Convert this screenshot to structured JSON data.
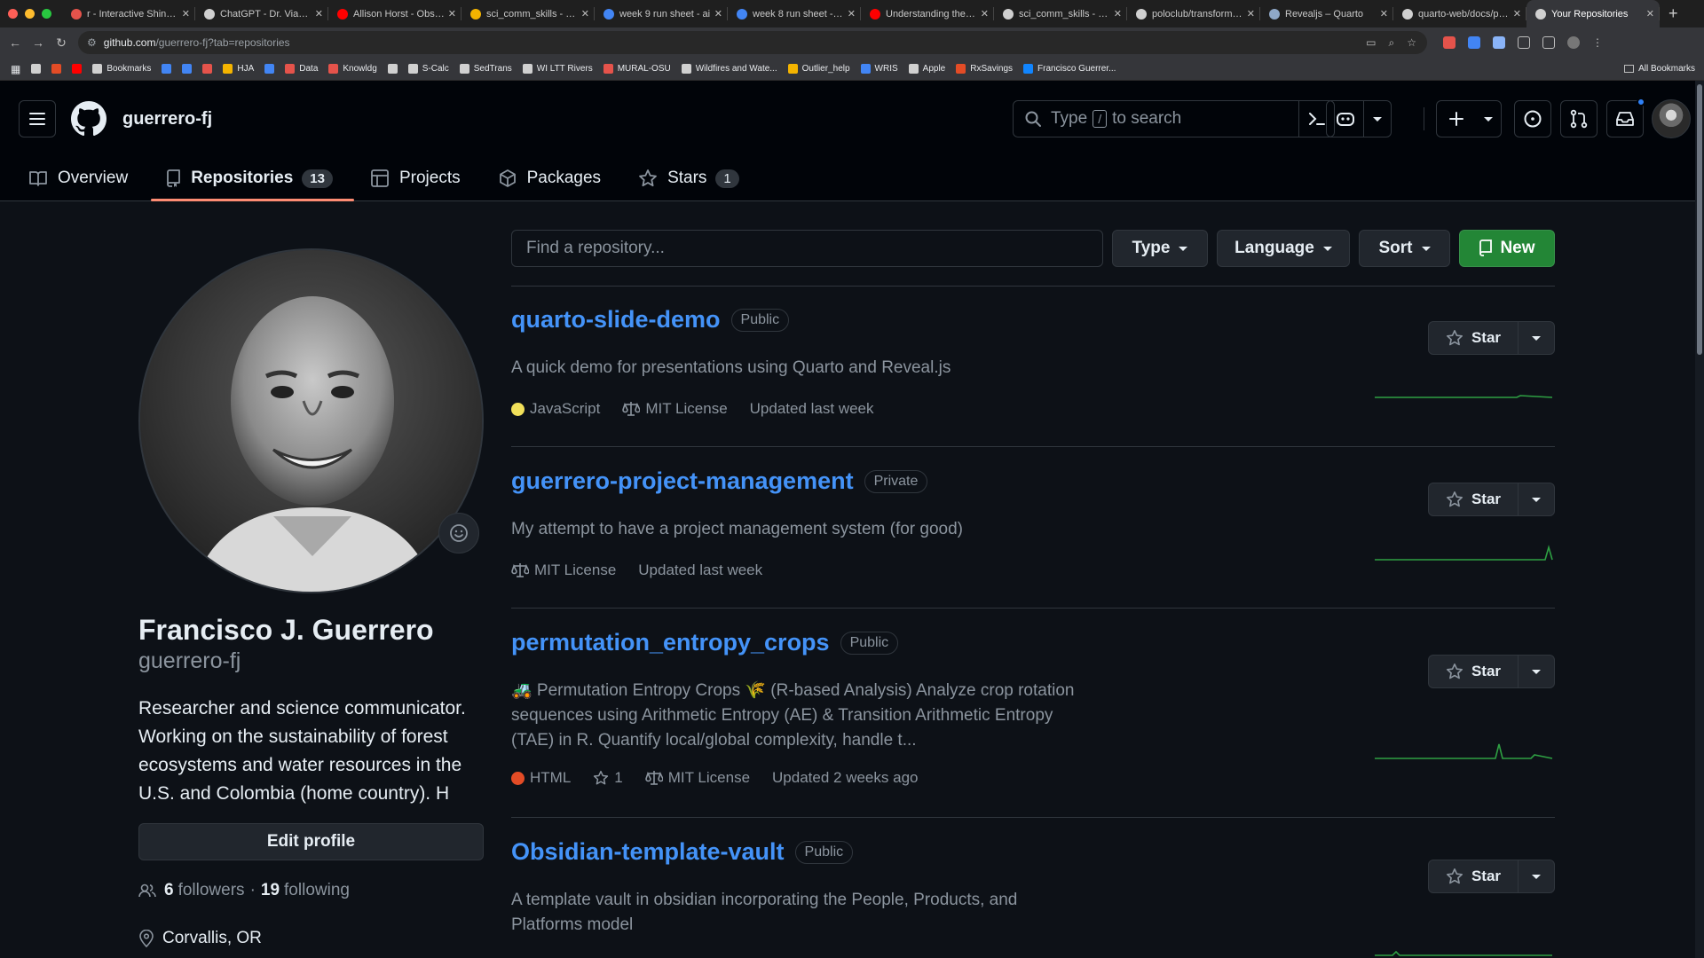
{
  "browser": {
    "tabs": [
      {
        "title": "r - Interactive Shiny or",
        "color": "#e5534b"
      },
      {
        "title": "ChatGPT - Dr. Viana A",
        "color": "#d0d0d0"
      },
      {
        "title": "Allison Horst - Observ",
        "color": "#ff0000"
      },
      {
        "title": "sci_comm_skills - Goo",
        "color": "#f4b400"
      },
      {
        "title": "week 9 run sheet - ai",
        "color": "#4285f4"
      },
      {
        "title": "week 8 run sheet - slic",
        "color": "#4285f4"
      },
      {
        "title": "Understanding the Pri",
        "color": "#ff0000"
      },
      {
        "title": "sci_comm_skills - wee",
        "color": "#d0d0d0"
      },
      {
        "title": "poloclub/transformer-",
        "color": "#d0d0d0"
      },
      {
        "title": "Revealjs – Quarto",
        "color": "#8fa8c8"
      },
      {
        "title": "quarto-web/docs/pres",
        "color": "#d0d0d0"
      },
      {
        "title": "Your Repositories",
        "color": "#d0d0d0",
        "active": true
      }
    ],
    "url_host": "github.com",
    "url_path": "/guerrero-fj?tab=repositories",
    "bookmarks": [
      {
        "label": "",
        "color": "#d0d0d0"
      },
      {
        "label": "",
        "color": "#e34c26"
      },
      {
        "label": "",
        "color": "#ff0000"
      },
      {
        "label": "Bookmarks",
        "color": "#d0d0d0"
      },
      {
        "label": "",
        "color": "#4285f4"
      },
      {
        "label": "",
        "color": "#4285f4"
      },
      {
        "label": "",
        "color": "#e5534b"
      },
      {
        "label": "HJA",
        "color": "#f4b400"
      },
      {
        "label": "",
        "color": "#4285f4"
      },
      {
        "label": "Data",
        "color": "#e5534b"
      },
      {
        "label": "Knowldg",
        "color": "#e5534b"
      },
      {
        "label": "",
        "color": "#d0d0d0"
      },
      {
        "label": "S-Calc",
        "color": "#d0d0d0"
      },
      {
        "label": "SedTrans",
        "color": "#d0d0d0"
      },
      {
        "label": "WI LTT Rivers",
        "color": "#d0d0d0"
      },
      {
        "label": "MURAL-OSU",
        "color": "#e5534b"
      },
      {
        "label": "Wildfires and Wate...",
        "color": "#d0d0d0"
      },
      {
        "label": "Outlier_help",
        "color": "#f4b400"
      },
      {
        "label": "WRIS",
        "color": "#4285f4"
      },
      {
        "label": "Apple",
        "color": "#d0d0d0"
      },
      {
        "label": "RxSavings",
        "color": "#e34c26"
      },
      {
        "label": "Francisco Guerrer...",
        "color": "#1185fe"
      }
    ],
    "all_bookmarks": "All Bookmarks"
  },
  "header": {
    "username": "guerrero-fj",
    "search_prefix": "Type",
    "search_key": "/",
    "search_suffix": "to search"
  },
  "nav": {
    "overview": "Overview",
    "repositories": "Repositories",
    "repositories_count": "13",
    "projects": "Projects",
    "packages": "Packages",
    "stars": "Stars",
    "stars_count": "1"
  },
  "profile": {
    "name": "Francisco J. Guerrero",
    "login": "guerrero-fj",
    "bio": "Researcher and science communicator. Working on the sustainability of forest ecosystems and water resources in the U.S. and Colombia (home country). H",
    "edit_button": "Edit profile",
    "followers_count": "6",
    "followers_label": "followers",
    "separator": "·",
    "following_count": "19",
    "following_label": "following",
    "location": "Corvallis, OR"
  },
  "filters": {
    "find_placeholder": "Find a repository...",
    "type": "Type",
    "language": "Language",
    "sort": "Sort",
    "new": "New"
  },
  "repos": [
    {
      "name": "quarto-slide-demo",
      "visibility": "Public",
      "description": "A quick demo for presentations using Quarto and Reveal.js",
      "language": "JavaScript",
      "language_color": "#f1e05a",
      "license": "MIT License",
      "updated": "Updated last week",
      "star_label": "Star"
    },
    {
      "name": "guerrero-project-management",
      "visibility": "Private",
      "description": "My attempt to have a project management system (for good)",
      "license": "MIT License",
      "updated": "Updated last week",
      "star_label": "Star"
    },
    {
      "name": "permutation_entropy_crops",
      "visibility": "Public",
      "description": "🚜 Permutation Entropy Crops 🌾 (R-based Analysis) Analyze crop rotation sequences using Arithmetic Entropy (AE) & Transition Arithmetic Entropy (TAE) in R. Quantify local/global complexity, handle t...",
      "language": "HTML",
      "language_color": "#e34c26",
      "stars": "1",
      "license": "MIT License",
      "updated": "Updated 2 weeks ago",
      "star_label": "Star"
    },
    {
      "name": "Obsidian-template-vault",
      "visibility": "Public",
      "description": "A template vault in obsidian incorporating the People, Products, and Platforms model",
      "star_label": "Star"
    }
  ],
  "colors": {
    "accent_link": "#4493f8",
    "new_button": "#238636",
    "nav_underline": "#fd8c73",
    "sparkline": "#2ea043"
  }
}
